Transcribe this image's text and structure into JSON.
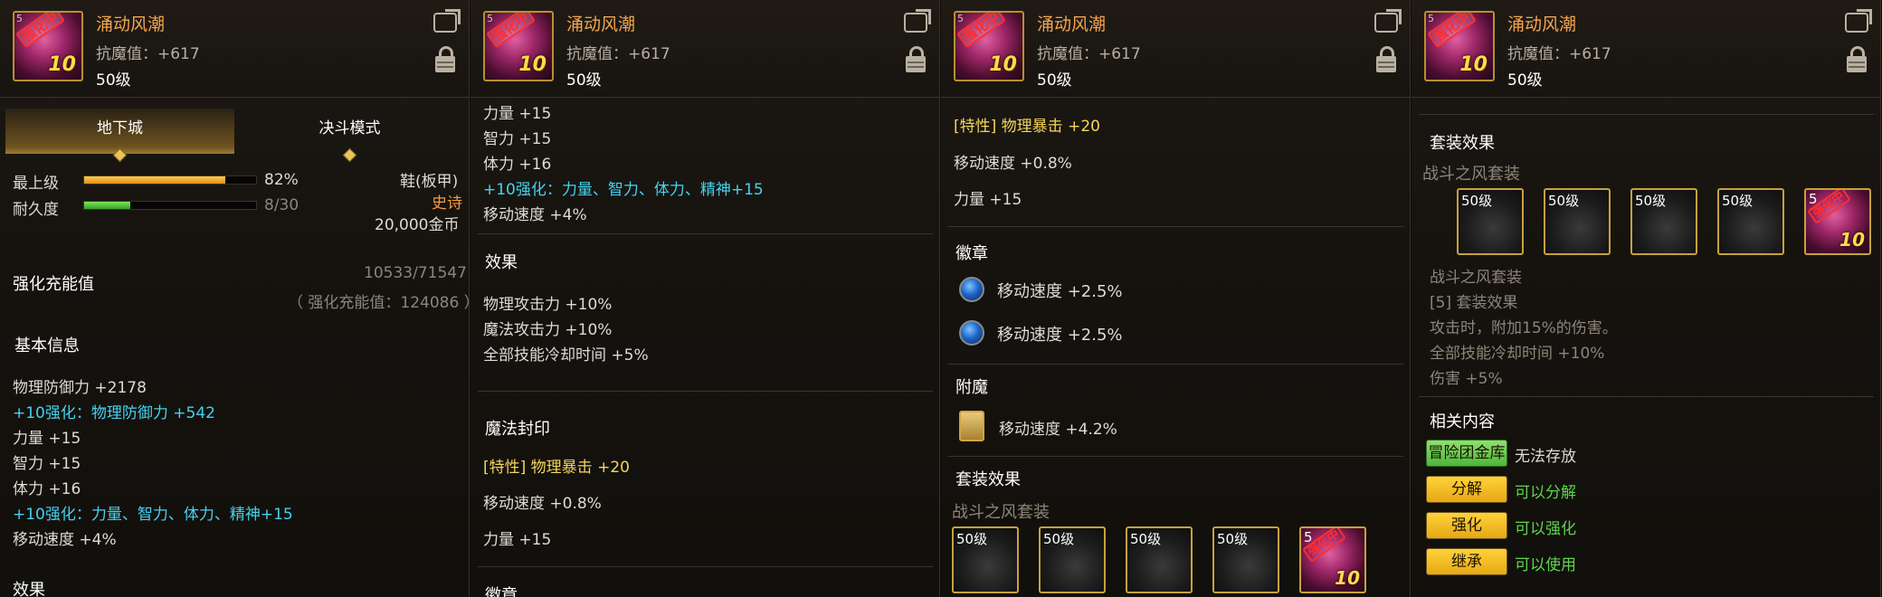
{
  "item": {
    "name": "涌动风潮",
    "stat": "抗魔值：+617",
    "level": "50级",
    "stamp": "强化中",
    "enhance": "10",
    "corner": "5"
  },
  "p1": {
    "tab_dungeon": "地下城",
    "tab_pvp": "决斗模式",
    "grade_label": "最上级",
    "grade_value": "82%",
    "grade_fill": 0.82,
    "dur_label": "耐久度",
    "dur_value": "8/30",
    "dur_fill": 0.267,
    "slot_type": "鞋(板甲)",
    "rarity": "史诗",
    "price": "20,000金币",
    "charge_label": "强化充能值",
    "charge_value": "10533/71547",
    "charge_sub": "（ 强化充能值：124086 ）",
    "basic_title": "基本信息",
    "lines": [
      "物理防御力 +2178",
      "+10强化：物理防御力 +542",
      "力量 +15",
      "智力 +15",
      "体力 +16",
      "+10强化：力量、智力、体力、精神+15",
      "移动速度 +4%"
    ],
    "cut_title": "效果"
  },
  "p2": {
    "lines": [
      "力量 +15",
      "智力 +15",
      "体力 +16",
      "+10强化：力量、智力、体力、精神+15",
      "移动速度 +4%"
    ],
    "effect_title": "效果",
    "effects": [
      "物理攻击力 +10%",
      "魔法攻击力 +10%",
      "全部技能冷却时间 +5%"
    ],
    "seal_title": "魔法封印",
    "seal_special": "[特性] 物理暴击 +20",
    "seal_move": "移动速度 +0.8%",
    "seal_str": "力量 +15",
    "cut_title": "徽章"
  },
  "p3": {
    "seal_special": "[特性] 物理暴击 +20",
    "seal_move": "移动速度 +0.8%",
    "seal_str": "力量 +15",
    "emblem_title": "徽章",
    "emblems": [
      "移动速度 +2.5%",
      "移动速度 +2.5%"
    ],
    "enchant_title": "附魔",
    "enchant": "移动速度 +4.2%",
    "set_title": "套装效果",
    "set_name": "战斗之风套装",
    "slot_label": "50级"
  },
  "p4": {
    "set_title": "套装效果",
    "set_name": "战斗之风套装",
    "slot_label": "50级",
    "set_name2": "战斗之风套装",
    "set_count": "[5] 套装效果",
    "set_lines": [
      "攻击时，附加15%的伤害。",
      "全部技能冷却时间 +10%",
      "伤害 +5%"
    ],
    "related_title": "相关内容",
    "actions": [
      {
        "btn": "冒险团金库",
        "text": "无法存放"
      },
      {
        "btn": "分解",
        "text": "可以分解"
      },
      {
        "btn": "强化",
        "text": "可以强化"
      },
      {
        "btn": "继承",
        "text": "可以使用"
      }
    ]
  },
  "colors": {
    "name": "#f2a550",
    "cyan": "#45d2ee",
    "special": "#f5d65a",
    "rarity": "#f49b3c",
    "green": "#5ed44e",
    "bar_grade": "#f0a42a",
    "bar_dur": "#56c83c"
  }
}
